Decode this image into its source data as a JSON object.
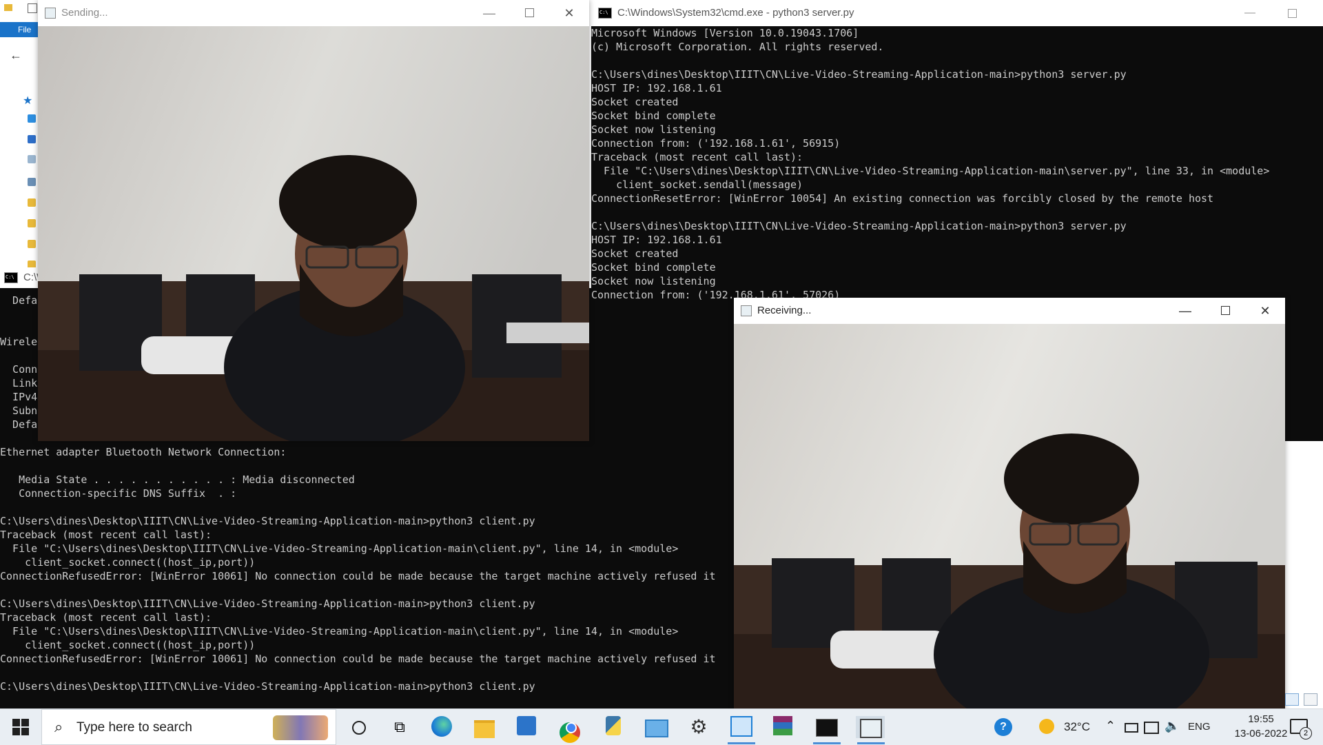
{
  "explorer": {
    "file_tab": "File"
  },
  "client_terminal": {
    "title": "C:\\W",
    "lines_top": [
      "  Defa",
      "",
      "",
      "Wireles",
      "",
      "  Conn",
      "  Link",
      "  IPv4",
      "  Subn",
      "  Defa"
    ],
    "lines": [
      "Ethernet adapter Bluetooth Network Connection:",
      "",
      "   Media State . . . . . . . . . . . : Media disconnected",
      "   Connection-specific DNS Suffix  . :",
      "",
      "C:\\Users\\dines\\Desktop\\IIIT\\CN\\Live-Video-Streaming-Application-main>python3 client.py",
      "Traceback (most recent call last):",
      "  File \"C:\\Users\\dines\\Desktop\\IIIT\\CN\\Live-Video-Streaming-Application-main\\client.py\", line 14, in <module>",
      "    client_socket.connect((host_ip,port))",
      "ConnectionRefusedError: [WinError 10061] No connection could be made because the target machine actively refused it",
      "",
      "C:\\Users\\dines\\Desktop\\IIIT\\CN\\Live-Video-Streaming-Application-main>python3 client.py",
      "Traceback (most recent call last):",
      "  File \"C:\\Users\\dines\\Desktop\\IIIT\\CN\\Live-Video-Streaming-Application-main\\client.py\", line 14, in <module>",
      "    client_socket.connect((host_ip,port))",
      "ConnectionRefusedError: [WinError 10061] No connection could be made because the target machine actively refused it",
      "",
      "C:\\Users\\dines\\Desktop\\IIIT\\CN\\Live-Video-Streaming-Application-main>python3 client.py"
    ]
  },
  "server_terminal": {
    "title": "C:\\Windows\\System32\\cmd.exe - python3  server.py",
    "lines": [
      "Microsoft Windows [Version 10.0.19043.1706]",
      "(c) Microsoft Corporation. All rights reserved.",
      "",
      "C:\\Users\\dines\\Desktop\\IIIT\\CN\\Live-Video-Streaming-Application-main>python3 server.py",
      "HOST IP: 192.168.1.61",
      "Socket created",
      "Socket bind complete",
      "Socket now listening",
      "Connection from: ('192.168.1.61', 56915)",
      "Traceback (most recent call last):",
      "  File \"C:\\Users\\dines\\Desktop\\IIIT\\CN\\Live-Video-Streaming-Application-main\\server.py\", line 33, in <module>",
      "    client_socket.sendall(message)",
      "ConnectionResetError: [WinError 10054] An existing connection was forcibly closed by the remote host",
      "",
      "C:\\Users\\dines\\Desktop\\IIIT\\CN\\Live-Video-Streaming-Application-main>python3 server.py",
      "HOST IP: 192.168.1.61",
      "Socket created",
      "Socket bind complete",
      "Socket now listening",
      "Connection from: ('192.168.1.61', 57026)"
    ]
  },
  "sending_window": {
    "title": "Sending..."
  },
  "receiving_window": {
    "title": "Receiving..."
  },
  "taskbar": {
    "search_placeholder": "Type here to search",
    "temperature": "32°C",
    "language": "ENG",
    "time": "19:55",
    "date": "13-06-2022",
    "notification_count": "2"
  }
}
